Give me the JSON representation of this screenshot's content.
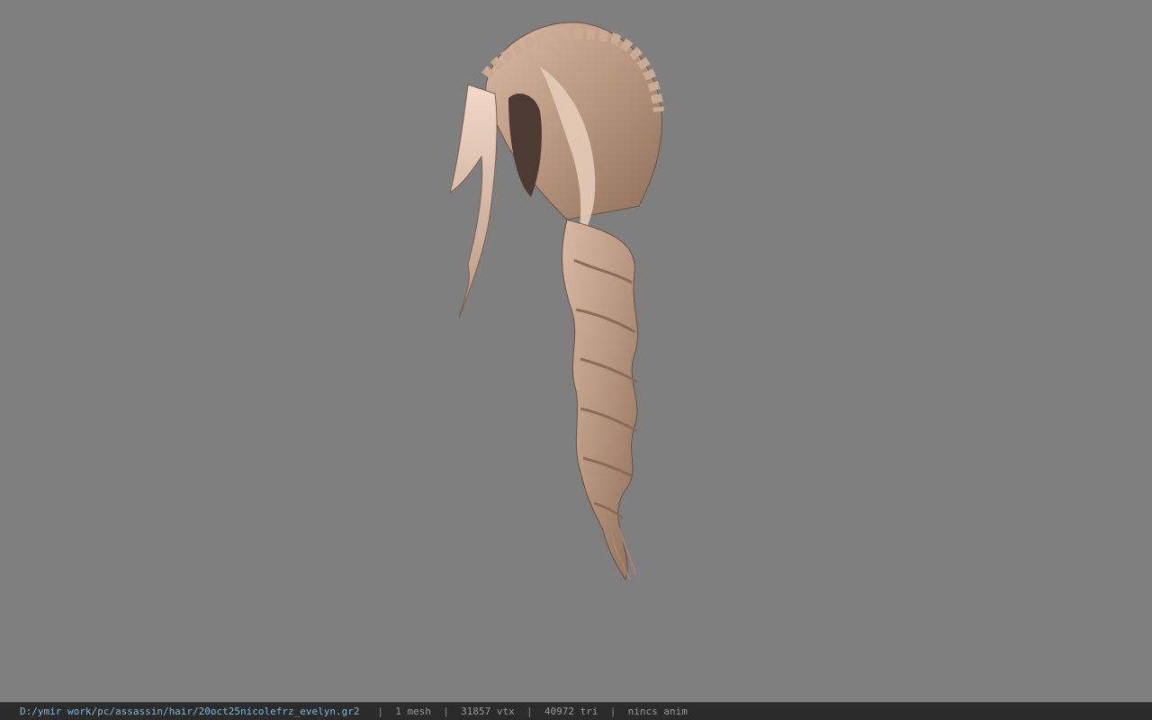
{
  "viewport": {
    "background_color": "#7f7f7f",
    "model_description_icon": "hair-mesh-icon"
  },
  "statusbar": {
    "file_path": "D:/ymir work/pc/assassin/hair/20oct25nicolefrz_evelyn.gr2",
    "mesh_count": "1 mesh",
    "vertex_count": "31857 vtx",
    "triangle_count": "40972 tri",
    "anim_status": "nincs anim",
    "separator": "|",
    "path_color": "#7fb8d8",
    "text_color": "#9a9a9a",
    "background_color": "#2b2b2b"
  }
}
